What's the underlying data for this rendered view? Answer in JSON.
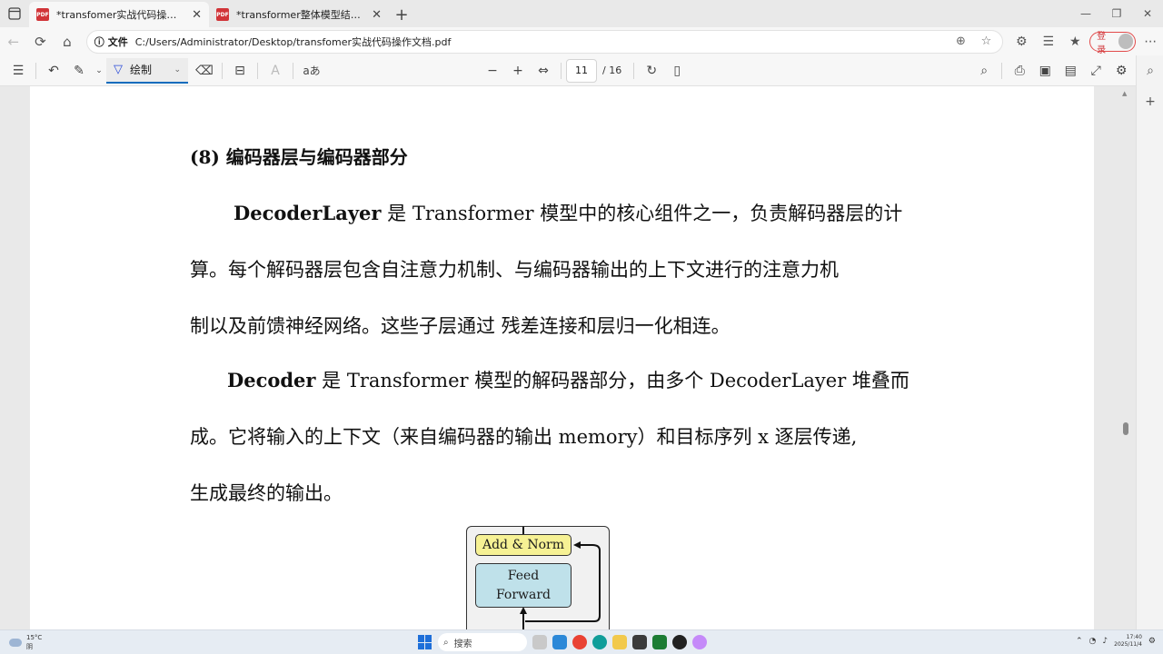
{
  "tabs": [
    {
      "title": "*transfomer实战代码操作文档.pdf",
      "close": "✕"
    },
    {
      "title": "*transformer整体模型结构.pdf",
      "close": "✕"
    }
  ],
  "new_tab": "+",
  "address": {
    "label": "文件",
    "url": "C:/Users/Administrator/Desktop/transfomer实战代码操作文档.pdf"
  },
  "login_label": "登录",
  "pdf_toolbar": {
    "draw_label": "绘制",
    "read_aloud": "aあ",
    "current_page": "11",
    "total_pages": "/ 16"
  },
  "document": {
    "heading": "(8)  编码器层与编码器部分",
    "p1": {
      "bold": "DecoderLayer",
      "l1_rest": " 是 Transformer 模型中的核心组件之一，负责解码器层的计",
      "l2": "算。每个解码器层包含自注意力机制、与编码器输出的上下文进行的注意力机",
      "l3": "制以及前馈神经网络。这些子层通过  残差连接和层归一化相连。"
    },
    "p2": {
      "bold": "Decoder",
      "l1_rest": " 是 Transformer  模型的解码器部分，由多个 DecoderLayer 堆叠而",
      "l2": "成。它将输入的上下文（来自编码器的输出 memory）和目标序列 x 逐层传递,",
      "l3": "生成最终的输出。"
    },
    "figure": {
      "add_norm": "Add & Norm",
      "ff_line1": "Feed",
      "ff_line2": "Forward"
    }
  },
  "taskbar": {
    "weather_temp": "15°C",
    "weather_desc": "阴",
    "search_placeholder": "搜索",
    "time": "17:40",
    "date": "2025/11/4"
  },
  "colors": {
    "accent": "#0f6cbd",
    "add_norm_fill": "#f6f194",
    "ff_fill": "#bfe1ea",
    "pdf_icon": "#d13438"
  }
}
